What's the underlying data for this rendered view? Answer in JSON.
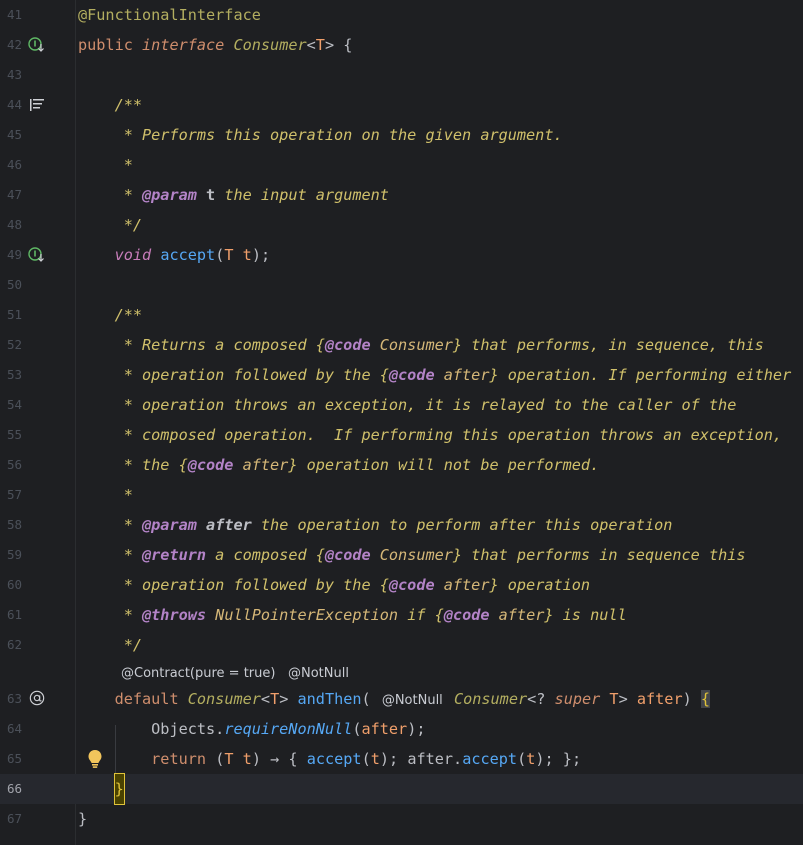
{
  "editor": {
    "lines": [
      {
        "num": "41"
      },
      {
        "num": "42"
      },
      {
        "num": "43"
      },
      {
        "num": "44"
      },
      {
        "num": "45"
      },
      {
        "num": "46"
      },
      {
        "num": "47"
      },
      {
        "num": "48"
      },
      {
        "num": "49"
      },
      {
        "num": "50"
      },
      {
        "num": "51"
      },
      {
        "num": "52"
      },
      {
        "num": "53"
      },
      {
        "num": "54"
      },
      {
        "num": "55"
      },
      {
        "num": "56"
      },
      {
        "num": "57"
      },
      {
        "num": "58"
      },
      {
        "num": "59"
      },
      {
        "num": "60"
      },
      {
        "num": "61"
      },
      {
        "num": "62"
      },
      {
        "num": "63"
      },
      {
        "num": "64"
      },
      {
        "num": "65"
      },
      {
        "num": "66"
      },
      {
        "num": "67"
      }
    ],
    "inlay": {
      "contract": "@Contract(pure = true)",
      "notnull": "@NotNull"
    },
    "param_inlay": "@NotNull",
    "gutter_icons": {
      "line42": "implemented-icon",
      "line44": "rendered-doc-icon",
      "line49": "implemented-icon",
      "line63": "at-icon",
      "line65": "lightbulb-icon"
    },
    "colors": {
      "background": "#1e1f22",
      "current_line": "#26282e",
      "keyword": "#cf8e6d",
      "doc": "#d0c06b"
    }
  }
}
